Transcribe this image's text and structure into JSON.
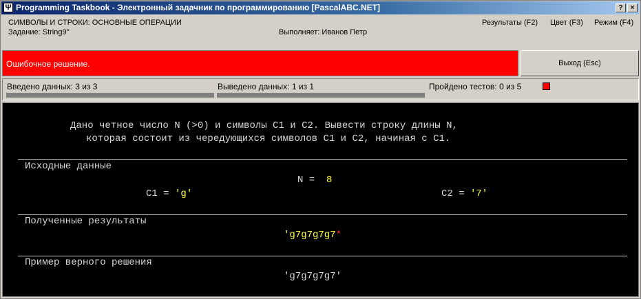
{
  "window": {
    "title": "Programming Taskbook - Электронный задачник по программированию [PascalABC.NET]",
    "icon_glyph": "Ψ",
    "help_glyph": "?",
    "close_glyph": "×"
  },
  "header": {
    "group": "СИМВОЛЫ И СТРОКИ: ОСНОВНЫЕ ОПЕРАЦИИ",
    "task": "Задание: String9°",
    "performer": "Выполняет: Иванов Петр",
    "menu_results": "Результаты (F2)",
    "menu_color": "Цвет (F3)",
    "menu_mode": "Режим (F4)"
  },
  "status": {
    "message": "Ошибочное решение.",
    "exit_label": "Выход (Esc)",
    "color": "#ff0000"
  },
  "stats": {
    "input": "Введено данных:  3 из 3",
    "output": "Выведено данных:  1 из 1",
    "tests": "Пройдено тестов:  0 из 5"
  },
  "console": {
    "task_line1_a": "Дано четное число N (>0) и символы C",
    "task_line1_b": "1",
    "task_line1_c": " и C",
    "task_line1_d": "2",
    "task_line1_e": ". Вывести строку длины N,",
    "task_line2_a": "которая состоит из чередующихся символов C",
    "task_line2_b": "1",
    "task_line2_c": " и C",
    "task_line2_d": "2",
    "task_line2_e": ", начиная с C",
    "task_line2_f": "1",
    "task_line2_g": ".",
    "section_input": "Исходные данные",
    "n_label": "N = ",
    "n_value": "8",
    "c1_label": "C",
    "c1_sub": "1",
    "c1_eq": " = ",
    "c1_value": "'g'",
    "c2_label": "C",
    "c2_sub": "2",
    "c2_eq": " = ",
    "c2_value": "'7'",
    "section_results": "Полученные результаты",
    "result_value": "'g7g7g7g7",
    "result_mark": "*",
    "section_example": "Пример верного решения",
    "example_value": "'g7g7g7g7'"
  }
}
